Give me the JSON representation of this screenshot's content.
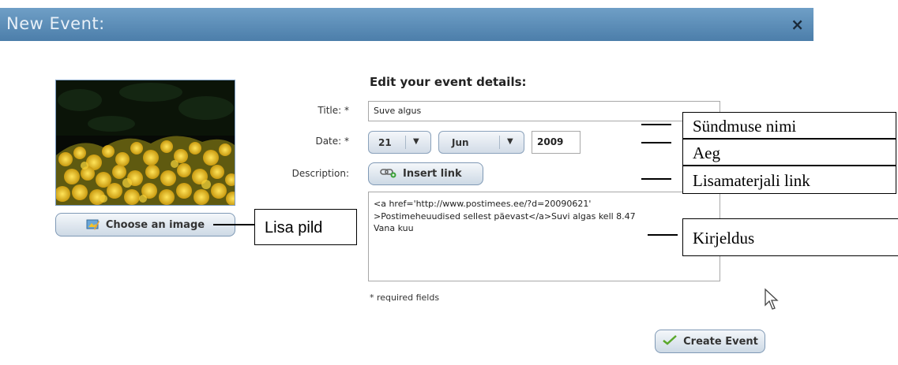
{
  "dialog": {
    "title": "New Event:",
    "close_label": "×"
  },
  "image_panel": {
    "choose_button": "Choose an image"
  },
  "form": {
    "heading": "Edit your event details:",
    "title_label": "Title: *",
    "title_value": "Suve algus",
    "date_label": "Date: *",
    "day": "21",
    "month": "Jun",
    "year": "2009",
    "description_label": "Description:",
    "insert_link_button": "Insert link",
    "description_lines": [
      "<a href='http://www.postimees.ee/?d=20090621'",
      ">Postimeheuudised sellest päevast</a>Suvi algas kell 8.47",
      "Vana kuu"
    ],
    "required_note": "* required fields",
    "create_button": "Create Event"
  },
  "annotations": {
    "title_callout": "Sündmuse nimi",
    "date_callout": "Aeg",
    "link_callout": "Lisamaterjali link",
    "image_callout": "Lisa pild",
    "description_callout": "Kirjeldus"
  },
  "icons": {
    "close": "close-icon",
    "choose_image": "image-icon",
    "insert_link": "link-icon",
    "create": "checkmark-icon",
    "cursor": "mouse-pointer-icon"
  }
}
